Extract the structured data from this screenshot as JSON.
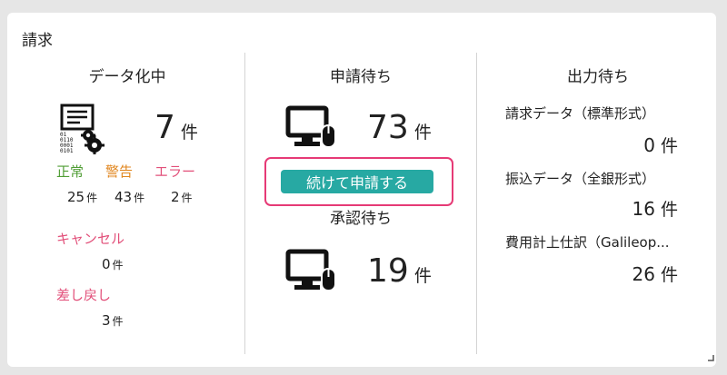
{
  "card": {
    "title": "請求"
  },
  "left": {
    "title": "データ化中",
    "count": "7",
    "unit": "件",
    "status_labels": [
      "正常",
      "警告",
      "エラー"
    ],
    "status_counts": [
      "25",
      "43",
      "2"
    ],
    "cancel_label": "キャンセル",
    "cancel_count": "0",
    "return_label": "差し戻し",
    "return_count": "3"
  },
  "middle": {
    "title": "申請待ち",
    "pending_count": "73",
    "unit": "件",
    "continue_button": "続けて申請する",
    "approval_title": "承認待ち",
    "approval_count": "19"
  },
  "right": {
    "title": "出力待ち",
    "items": [
      {
        "label": "請求データ（標準形式）",
        "count": "0",
        "unit": "件"
      },
      {
        "label": "振込データ（全銀形式）",
        "count": "16",
        "unit": "件"
      },
      {
        "label": "費用計上仕訳（Galileop...",
        "count": "26",
        "unit": "件"
      }
    ]
  },
  "icons": {
    "data_process": "data-processing-icon",
    "computer": "computer-mouse-icon"
  },
  "colors": {
    "accent": "#27a9a3",
    "ok": "#4f9d34",
    "warn": "#e0861e",
    "error": "#e2507a",
    "highlight": "#e63a76"
  }
}
